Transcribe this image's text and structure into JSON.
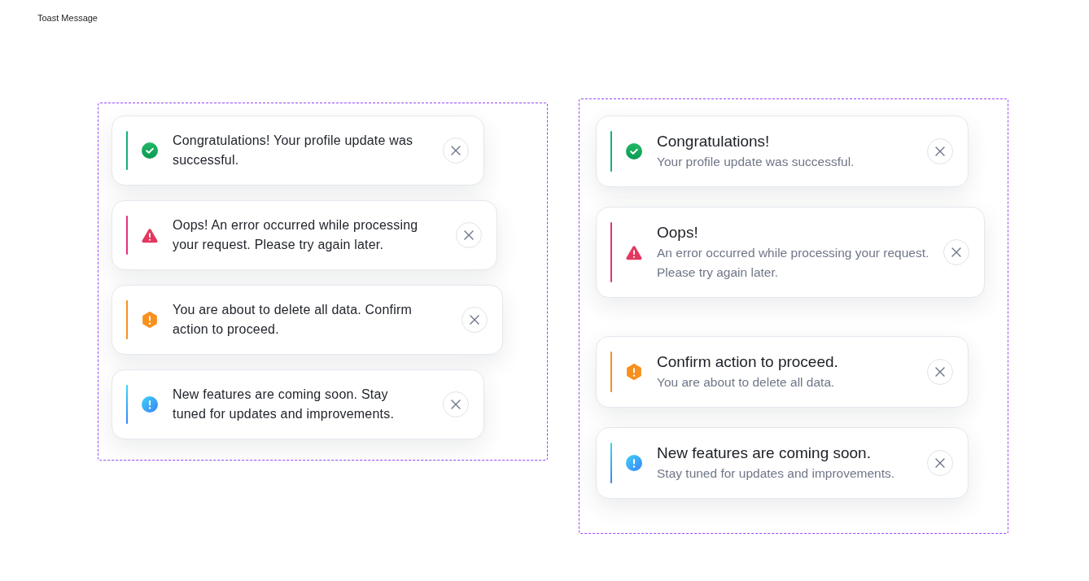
{
  "page_title": "Toast Message",
  "groups": [
    {
      "kind": "single",
      "toasts": [
        {
          "kind": "success",
          "message": "Congratulations! Your profile update was successful."
        },
        {
          "kind": "error",
          "message": "Oops! An error occurred while processing your request. Please try again later."
        },
        {
          "kind": "warning",
          "message": "You are about to delete all data. Confirm action to proceed."
        },
        {
          "kind": "info",
          "message": "New features are coming soon. Stay tuned for updates and improvements."
        }
      ]
    },
    {
      "kind": "titled",
      "toasts": [
        {
          "kind": "success",
          "title": "Congratulations!",
          "description": "Your profile update was successful."
        },
        {
          "kind": "error",
          "title": "Oops!",
          "description": "An error occurred while processing your request.\nPlease try again later."
        },
        {
          "kind": "warning",
          "title": "Confirm action to proceed.",
          "description": "You are about to delete all data."
        },
        {
          "kind": "info",
          "title": "New features are coming soon.",
          "description": "Stay tuned for updates and improvements."
        }
      ]
    }
  ]
}
